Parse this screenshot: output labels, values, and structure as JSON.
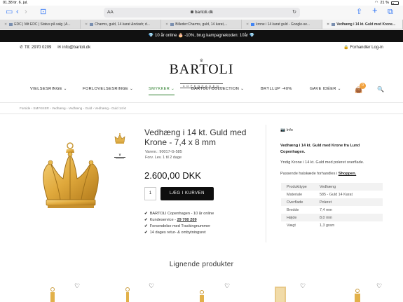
{
  "status_bar": {
    "time": "01.38",
    "date": "tir. 6. jul.",
    "battery": "21 %"
  },
  "browser": {
    "aa": "AA",
    "url": "bartoli.dk",
    "tabs": [
      {
        "label": "EDC | Mit EDC | Status på salg | A..."
      },
      {
        "label": "Charms, guld, 14 karat &ndash; d..."
      },
      {
        "label": "Billeder:Charms, guld, 14 karat,..."
      },
      {
        "label": "krone i 14 karat guld - Google-se..."
      },
      {
        "label": "Vedhæng i 14 kt. Guld med Krone..."
      }
    ]
  },
  "promo": {
    "text": "10 år online 🎂 -10%, brug kampagnekoden: 10år"
  },
  "utility": {
    "phone": "Tlf. 2970 0209",
    "email": "info@bartoli.dk",
    "dealer_login": "Forhandler Log-in"
  },
  "logo": {
    "name": "BARTOLI",
    "sub": "COPENHAGEN"
  },
  "nav": {
    "items": [
      {
        "label": "VIELSESRINGE"
      },
      {
        "label": "FORLOVELSESRINGE"
      },
      {
        "label": "SMYKKER"
      },
      {
        "label": "BARTOLI COLLECTION"
      },
      {
        "label": "BRYLLUP -40%"
      },
      {
        "label": "GAVE IDÉER"
      }
    ],
    "cart_count": "0"
  },
  "breadcrumb": "Forside › SMYKKER › Vedhæng › Vedhæng - Guld › Vedhæng - Guld 14 kt",
  "product": {
    "title": "Vedhæng i 14 kt. Guld med Krone - 7,4 x 8 mm",
    "sku": "Varenr.: 90017-G-585",
    "delivery": "Forv. Lev. 1 til 2 dage",
    "price": "2.600,00 DKK",
    "qty": "1",
    "add_to_cart": "LÆG I KURVEN",
    "usps": [
      {
        "text": "BARTOLI Copenhagen - 10 år online"
      },
      {
        "text": "Kundeservice - ",
        "link": "29 700 209"
      },
      {
        "text": "Forsendelse med Trackingnummer"
      },
      {
        "text": "14 dages retur- & ombytningsret"
      }
    ]
  },
  "info": {
    "heading": "Info",
    "title": "Vedhæng i 14 kt. Guld med Krone fra Lund Copenhagen.",
    "text1": "Yndig Krone i 14 kt. Guld med poleret overflade.",
    "text2": "Passende halskæde forhandles i ",
    "text2_link": "Shoppen.",
    "specs": [
      {
        "k": "Produkttype",
        "v": "Vedhæng"
      },
      {
        "k": "Materiale",
        "v": "585 - Guld 14 Karat"
      },
      {
        "k": "Overflade",
        "v": "Poleret"
      },
      {
        "k": "Bredde",
        "v": "7,4 mm"
      },
      {
        "k": "Højde",
        "v": "8,0 mm"
      },
      {
        "k": "Vægt",
        "v": "1,3 gram"
      }
    ]
  },
  "similar_heading": "Lignende produkter"
}
